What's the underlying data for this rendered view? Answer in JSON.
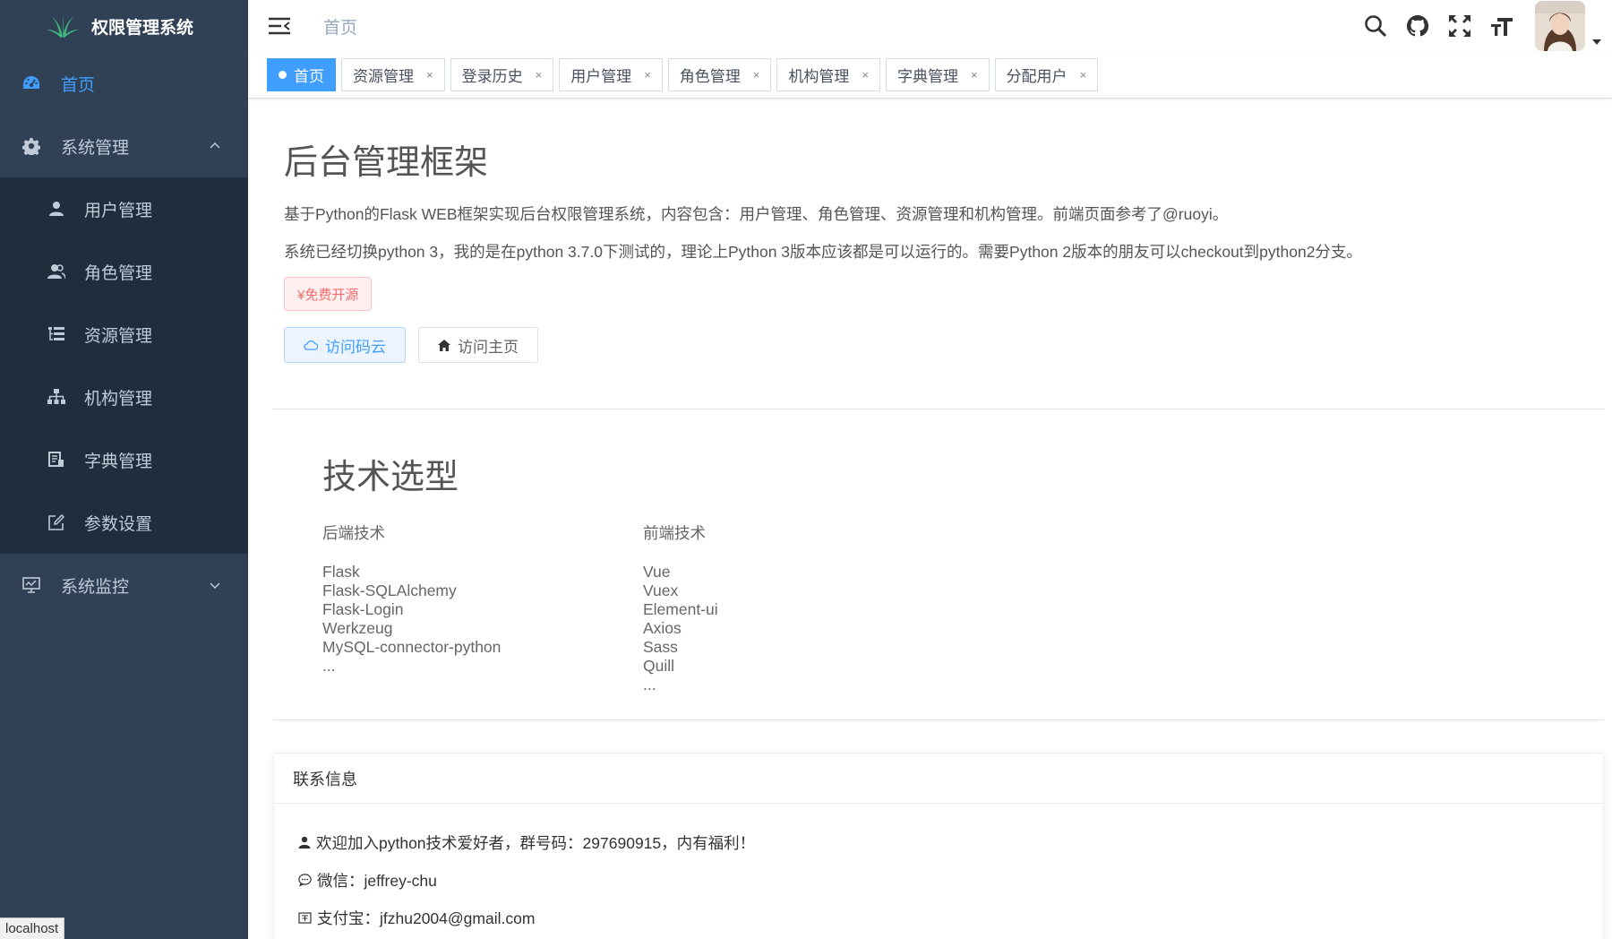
{
  "app": {
    "title": "权限管理系统"
  },
  "sidebar": {
    "items": [
      {
        "label": "首页",
        "icon": "dashboard-icon",
        "active": true
      },
      {
        "label": "系统管理",
        "icon": "gear-icon",
        "expanded": true,
        "children": [
          {
            "label": "用户管理",
            "icon": "user-icon"
          },
          {
            "label": "角色管理",
            "icon": "users-icon"
          },
          {
            "label": "资源管理",
            "icon": "tree-table-icon"
          },
          {
            "label": "机构管理",
            "icon": "org-tree-icon"
          },
          {
            "label": "字典管理",
            "icon": "dict-icon"
          },
          {
            "label": "参数设置",
            "icon": "edit-icon"
          }
        ]
      },
      {
        "label": "系统监控",
        "icon": "monitor-icon",
        "expanded": false
      }
    ]
  },
  "status_tip": "localhost",
  "navbar": {
    "breadcrumb": "首页",
    "icons": [
      "search-icon",
      "github-icon",
      "fullscreen-icon",
      "font-size-icon"
    ]
  },
  "tags": [
    {
      "label": "首页",
      "active": true
    },
    {
      "label": "资源管理",
      "closable": true
    },
    {
      "label": "登录历史",
      "closable": true
    },
    {
      "label": "用户管理",
      "closable": true
    },
    {
      "label": "角色管理",
      "closable": true
    },
    {
      "label": "机构管理",
      "closable": true
    },
    {
      "label": "字典管理",
      "closable": true
    },
    {
      "label": "分配用户",
      "closable": true
    }
  ],
  "tag_close_glyph": "×",
  "intro": {
    "title": "后台管理框架",
    "para1": "基于Python的Flask WEB框架实现后台权限管理系统，内容包含：用户管理、角色管理、资源管理和机构管理。前端页面参考了@ruoyi。",
    "para2": "系统已经切换python 3，我的是在python 3.7.0下测试的，理论上Python 3版本应该都是可以运行的。需要Python 2版本的朋友可以checkout到python2分支。",
    "free_tag": "¥免费开源",
    "btn_gitee": "访问码云",
    "btn_home": "访问主页"
  },
  "tech": {
    "title": "技术选型",
    "backend": {
      "title": "后端技术",
      "items": [
        "Flask",
        "Flask-SQLAlchemy",
        "Flask-Login",
        "Werkzeug",
        "MySQL-connector-python",
        "..."
      ]
    },
    "frontend": {
      "title": "前端技术",
      "items": [
        "Vue",
        "Vuex",
        "Element-ui",
        "Axios",
        "Sass",
        "Quill",
        "..."
      ]
    }
  },
  "contact": {
    "title": "联系信息",
    "qq_group": "欢迎加入python技术爱好者，群号码：297690915，内有福利！",
    "wechat": "微信：jeffrey-chu",
    "alipay": "支付宝：jfzhu2004@gmail.com"
  },
  "colors": {
    "sidebar_bg": "#304156",
    "submenu_bg": "#1f2d3d",
    "accent": "#409eff",
    "danger": "#f56c6c"
  }
}
